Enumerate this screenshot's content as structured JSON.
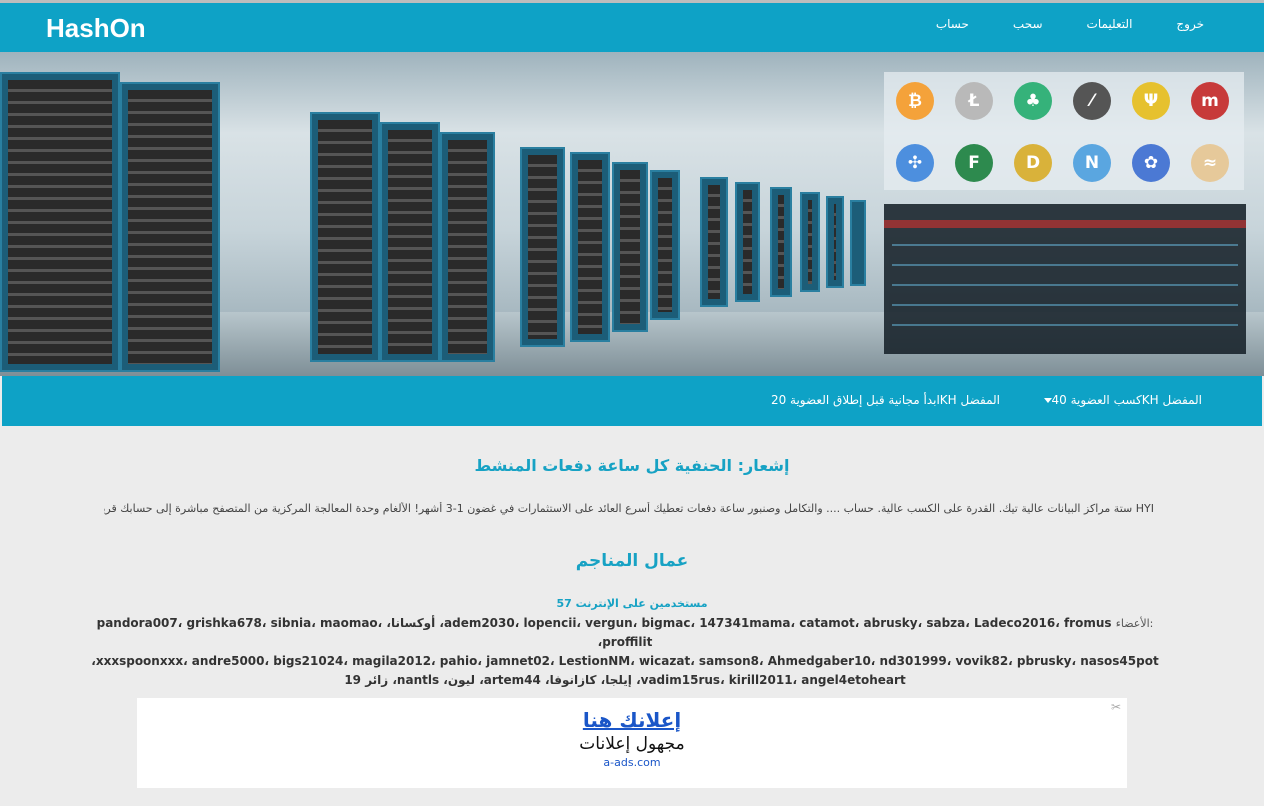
{
  "header": {
    "brand": "HashOn",
    "nav": [
      {
        "label": "خروج"
      },
      {
        "label": "التعليمات"
      },
      {
        "label": "سحب"
      },
      {
        "label": "حساب"
      }
    ]
  },
  "hero": {
    "coins": [
      {
        "icon": "bitcoin-icon",
        "glyph": "₿",
        "color": "#f4a23a"
      },
      {
        "icon": "litecoin-icon",
        "glyph": "Ł",
        "color": "#b9b9b9"
      },
      {
        "icon": "leaf-coin-icon",
        "glyph": "♣",
        "color": "#35b27a"
      },
      {
        "icon": "sword-coin-icon",
        "glyph": "⁄",
        "color": "#555555"
      },
      {
        "icon": "psi-coin-icon",
        "glyph": "Ψ",
        "color": "#e6c12e"
      },
      {
        "icon": "m-coin-icon",
        "glyph": "m",
        "color": "#c73a3a"
      },
      {
        "icon": "ripple-icon",
        "glyph": "✣",
        "color": "#4d8fde"
      },
      {
        "icon": "f-coin-icon",
        "glyph": "F",
        "color": "#2d8a4e"
      },
      {
        "icon": "dogecoin-icon",
        "glyph": "D",
        "color": "#d9b23a"
      },
      {
        "icon": "n-coin-icon",
        "glyph": "N",
        "color": "#5aa6e0"
      },
      {
        "icon": "atom-coin-icon",
        "glyph": "✿",
        "color": "#4b79d4"
      },
      {
        "icon": "wave-coin-icon",
        "glyph": "≈",
        "color": "#e6c99a"
      }
    ]
  },
  "membership": {
    "dropdown_label": "المفضل KHكسب العضوية 40",
    "free_label": "المفضل KHابدأ مجانية قبل إطلاق العضوية 20"
  },
  "notice": {
    "title": "إشعار: الحنفية كل ساعة دفعات المنشط",
    "text": "HYI ستة مراكز البيانات عالية تيك. القدرة على الكسب عالية. حساب .... والتكامل وصنبور ساعة دفعات تعطيك أسرع العائد على الاستثمارات في غضون 1-3 أشهر! الألغام وحدة المعالجة المركزية من المتصفح مباشرة إلى حسابك قريبا"
  },
  "miners": {
    "title": "عمال المناجم",
    "online": "مستخدمين على الإنترنت 57",
    "members_label": ":الأعضاء",
    "members_line1": "adem2030، lopencii، vergun، bigmac، 147341mama، catamot، abrusky، sabza، Ladeco2016، fromus، أوكسانا، pandora007، grishka678، sibnia، maomao، proffilit،",
    "members_line2": "xxxspoonxxx، andre5000، bigs21024، magila2012، pahio، jamnet02، LestionNM، wicazat، samson8، Ahmedgaber10، nd301999، vovik82، pbrusky، nasos45pot،",
    "members_line3": "vadim15rus، kirill2011، angel4etoheart، إيلجا، كازانوفا، artem44، ليون، nantls، زائر 19"
  },
  "ad": {
    "title": "إعلانك هنا",
    "subtitle": "مجهول إعلانات",
    "url": "a-ads.com"
  }
}
